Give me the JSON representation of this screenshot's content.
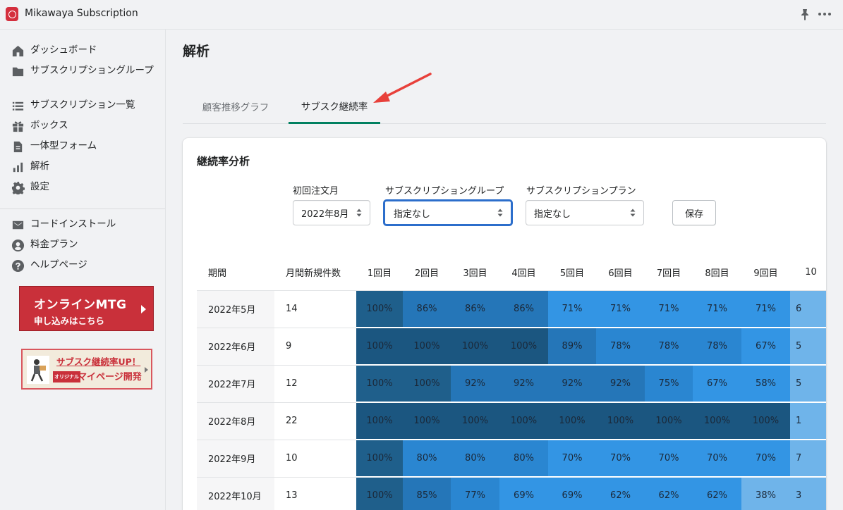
{
  "app": {
    "title": "Mikawaya Subscription"
  },
  "sidebar": {
    "items": [
      {
        "label": "ダッシュボード",
        "icon": "home-icon"
      },
      {
        "label": "サブスクリプショングループ",
        "icon": "folder-icon"
      },
      {
        "label": "サブスクリプション一覧",
        "icon": "list-icon"
      },
      {
        "label": "ボックス",
        "icon": "gift-icon"
      },
      {
        "label": "一体型フォーム",
        "icon": "document-icon"
      },
      {
        "label": "解析",
        "icon": "analytics-icon"
      },
      {
        "label": "設定",
        "icon": "gear-icon"
      },
      {
        "label": "コードインストール",
        "icon": "email-icon"
      },
      {
        "label": "料金プラン",
        "icon": "user-circle-icon"
      },
      {
        "label": "ヘルプページ",
        "icon": "help-icon"
      }
    ],
    "promo1": {
      "line1": "オンラインMTG",
      "line2": "申し込みはこちら"
    },
    "promo2": {
      "line1": "サブスク継続率UP！",
      "tag": "オリジナル",
      "line2": "マイページ開発"
    }
  },
  "page": {
    "title": "解析"
  },
  "tabs": [
    {
      "label": "顧客推移グラフ"
    },
    {
      "label": "サブスク継続率"
    }
  ],
  "card": {
    "title": "継続率分析",
    "filters": {
      "order_month": {
        "label": "初回注文月",
        "value": "2022年8月"
      },
      "group": {
        "label": "サブスクリプショングループ",
        "value": "指定なし"
      },
      "plan": {
        "label": "サブスクリプションプラン",
        "value": "指定なし"
      }
    },
    "save_label": "保存"
  },
  "table": {
    "headers": [
      "期間",
      "月間新規件数",
      "1回目",
      "2回目",
      "3回目",
      "4回目",
      "5回目",
      "6回目",
      "7回目",
      "8回目",
      "9回目",
      "10"
    ],
    "rows": [
      {
        "period": "2022年5月",
        "count": "14",
        "values": [
          "100%",
          "86%",
          "86%",
          "86%",
          "71%",
          "71%",
          "71%",
          "71%",
          "71%",
          "6"
        ]
      },
      {
        "period": "2022年6月",
        "count": "9",
        "values": [
          "100%",
          "100%",
          "100%",
          "100%",
          "89%",
          "78%",
          "78%",
          "78%",
          "67%",
          "5"
        ]
      },
      {
        "period": "2022年7月",
        "count": "12",
        "values": [
          "100%",
          "100%",
          "92%",
          "92%",
          "92%",
          "92%",
          "75%",
          "67%",
          "58%",
          "5"
        ]
      },
      {
        "period": "2022年8月",
        "count": "22",
        "values": [
          "100%",
          "100%",
          "100%",
          "100%",
          "100%",
          "100%",
          "100%",
          "100%",
          "100%",
          "1"
        ]
      },
      {
        "period": "2022年9月",
        "count": "10",
        "values": [
          "100%",
          "80%",
          "80%",
          "80%",
          "70%",
          "70%",
          "70%",
          "70%",
          "70%",
          "7"
        ]
      },
      {
        "period": "2022年10月",
        "count": "13",
        "values": [
          "100%",
          "85%",
          "77%",
          "69%",
          "69%",
          "62%",
          "62%",
          "62%",
          "38%",
          "3"
        ]
      }
    ],
    "colors": {
      "c100": "#1f5f8b",
      "c100_hi": "#1b5680",
      "c89": "#2576b8",
      "c78": "#2a86d1",
      "c70": "#3395e4",
      "c38": "#6fb4ea"
    }
  }
}
